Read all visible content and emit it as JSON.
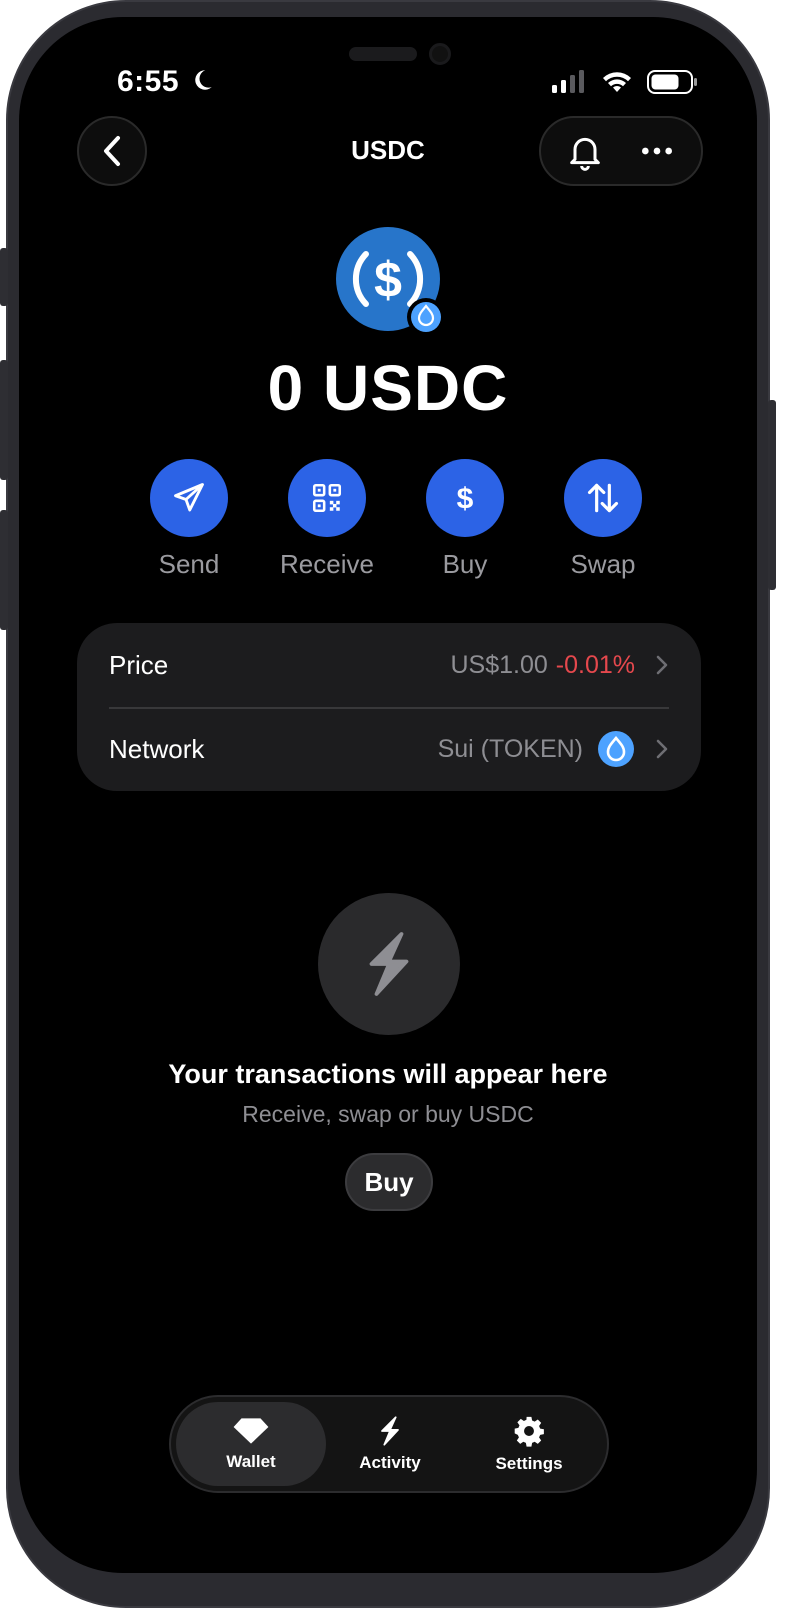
{
  "status_bar": {
    "time": "6:55"
  },
  "header": {
    "title": "USDC"
  },
  "token": {
    "balance": "0 USDC"
  },
  "actions": [
    {
      "label": "Send",
      "icon": "send-icon"
    },
    {
      "label": "Receive",
      "icon": "qr-code-icon"
    },
    {
      "label": "Buy",
      "icon": "dollar-icon"
    },
    {
      "label": "Swap",
      "icon": "swap-arrows-icon"
    }
  ],
  "info": {
    "price_label": "Price",
    "price_value": "US$1.00",
    "price_change": "-0.01%",
    "network_label": "Network",
    "network_value": "Sui (TOKEN)"
  },
  "empty_state": {
    "title": "Your transactions will appear here",
    "subtitle": "Receive, swap or buy USDC",
    "button": "Buy"
  },
  "tabs": [
    {
      "label": "Wallet",
      "active": true
    },
    {
      "label": "Activity",
      "active": false
    },
    {
      "label": "Settings",
      "active": false
    }
  ],
  "colors": {
    "accent": "#2c63e6",
    "negative": "#e5484d",
    "usdc_blue": "#2775ca",
    "sui_blue": "#4da2ff"
  }
}
